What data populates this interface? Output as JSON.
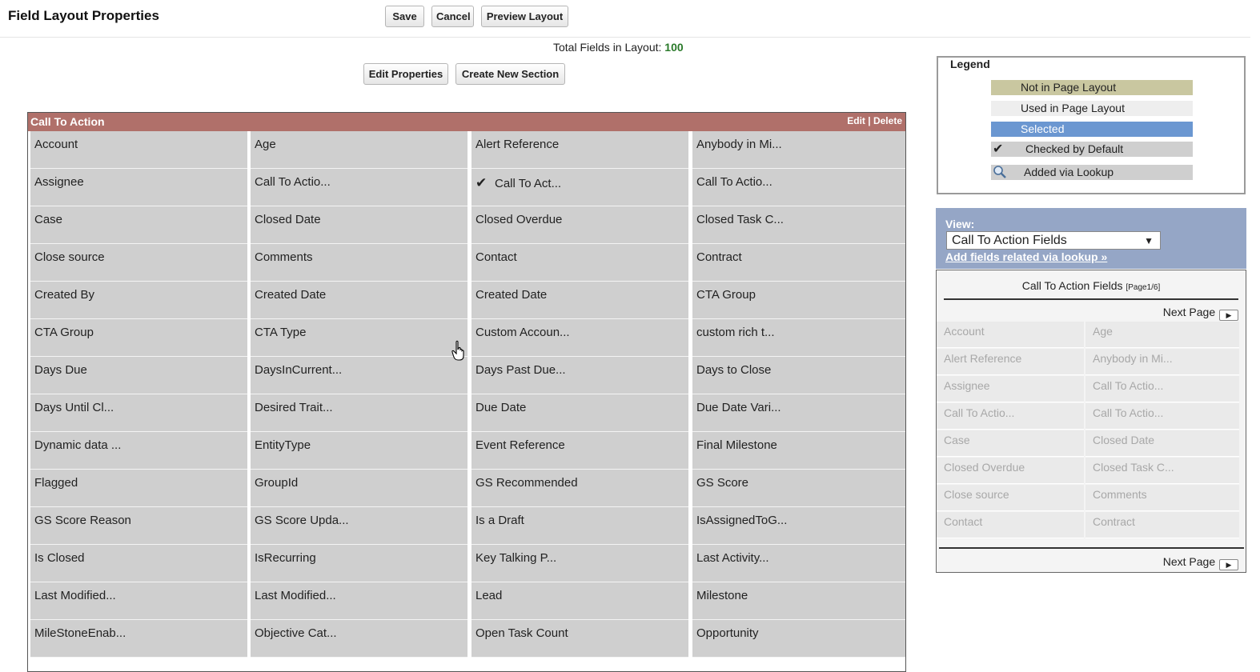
{
  "header": {
    "title": "Field Layout Properties",
    "save_label": "Save",
    "cancel_label": "Cancel",
    "preview_label": "Preview Layout",
    "total_label": "Total Fields in Layout:",
    "total_value": "100",
    "edit_properties_label": "Edit Properties",
    "create_section_label": "Create New Section"
  },
  "section": {
    "title": "Call To Action",
    "edit_label": "Edit",
    "separator": " | ",
    "delete_label": "Delete",
    "columns": [
      [
        "Account",
        "Assignee",
        "Case",
        "Close source",
        "Created By",
        "CTA Group",
        "Days Due",
        "Days Until Cl...",
        "Dynamic data ...",
        "Flagged",
        "GS Score Reason",
        "Is Closed",
        "Last Modified...",
        "MileStoneEnab..."
      ],
      [
        "Age",
        "Call To Actio...",
        "Closed Date",
        "Comments",
        "Created Date",
        "CTA Type",
        "DaysInCurrent...",
        "Desired Trait...",
        "EntityType",
        "GroupId",
        "GS Score Upda...",
        "IsRecurring",
        "Last Modified...",
        "Objective Cat..."
      ],
      [
        "Alert Reference",
        "Call To Act...",
        "Closed Overdue",
        "Contact",
        "Created Date",
        "Custom Accoun...",
        "Days Past Due...",
        "Due Date",
        "Event Reference",
        "GS Recommended",
        "Is a Draft",
        "Key Talking P...",
        "Lead",
        "Open Task Count"
      ],
      [
        "Anybody in Mi...",
        "Call To Actio...",
        "Closed Task C...",
        "Contract",
        "CTA Group",
        "custom rich t...",
        "Days to Close",
        "Due Date Vari...",
        "Final Milestone",
        "GS Score",
        "IsAssignedToG...",
        "Last Activity...",
        "Milestone",
        "Opportunity"
      ]
    ],
    "checked_cell": "Call To Act..."
  },
  "legend": {
    "title": "Legend",
    "items": [
      {
        "label": "Not in Page Layout",
        "color": "#c9c7a0"
      },
      {
        "label": "Used in Page Layout",
        "color": "#eeeeee"
      },
      {
        "label": "Selected",
        "color": "#6b97d1"
      },
      {
        "label": "Checked by Default",
        "color": "#cfcfcf",
        "icon": "checkmark-icon"
      },
      {
        "label": "Added via Lookup",
        "color": "#cfcfcf",
        "icon": "magnifier-icon"
      }
    ]
  },
  "palette": {
    "view_label": "View:",
    "view_value": "Call To Action Fields",
    "lookup_link": "Add fields related via lookup »",
    "list_title": "Call To Action Fields",
    "page_info": "[Page1/6]",
    "next_page": "Next Page",
    "fields": [
      "Account",
      "Age",
      "Alert Reference",
      "Anybody in Mi...",
      "Assignee",
      "Call To Actio...",
      "Call To Actio...",
      "Call To Actio...",
      "Case",
      "Closed Date",
      "Closed Overdue",
      "Closed Task C...",
      "Close source",
      "Comments",
      "Contact",
      "Contract"
    ]
  }
}
